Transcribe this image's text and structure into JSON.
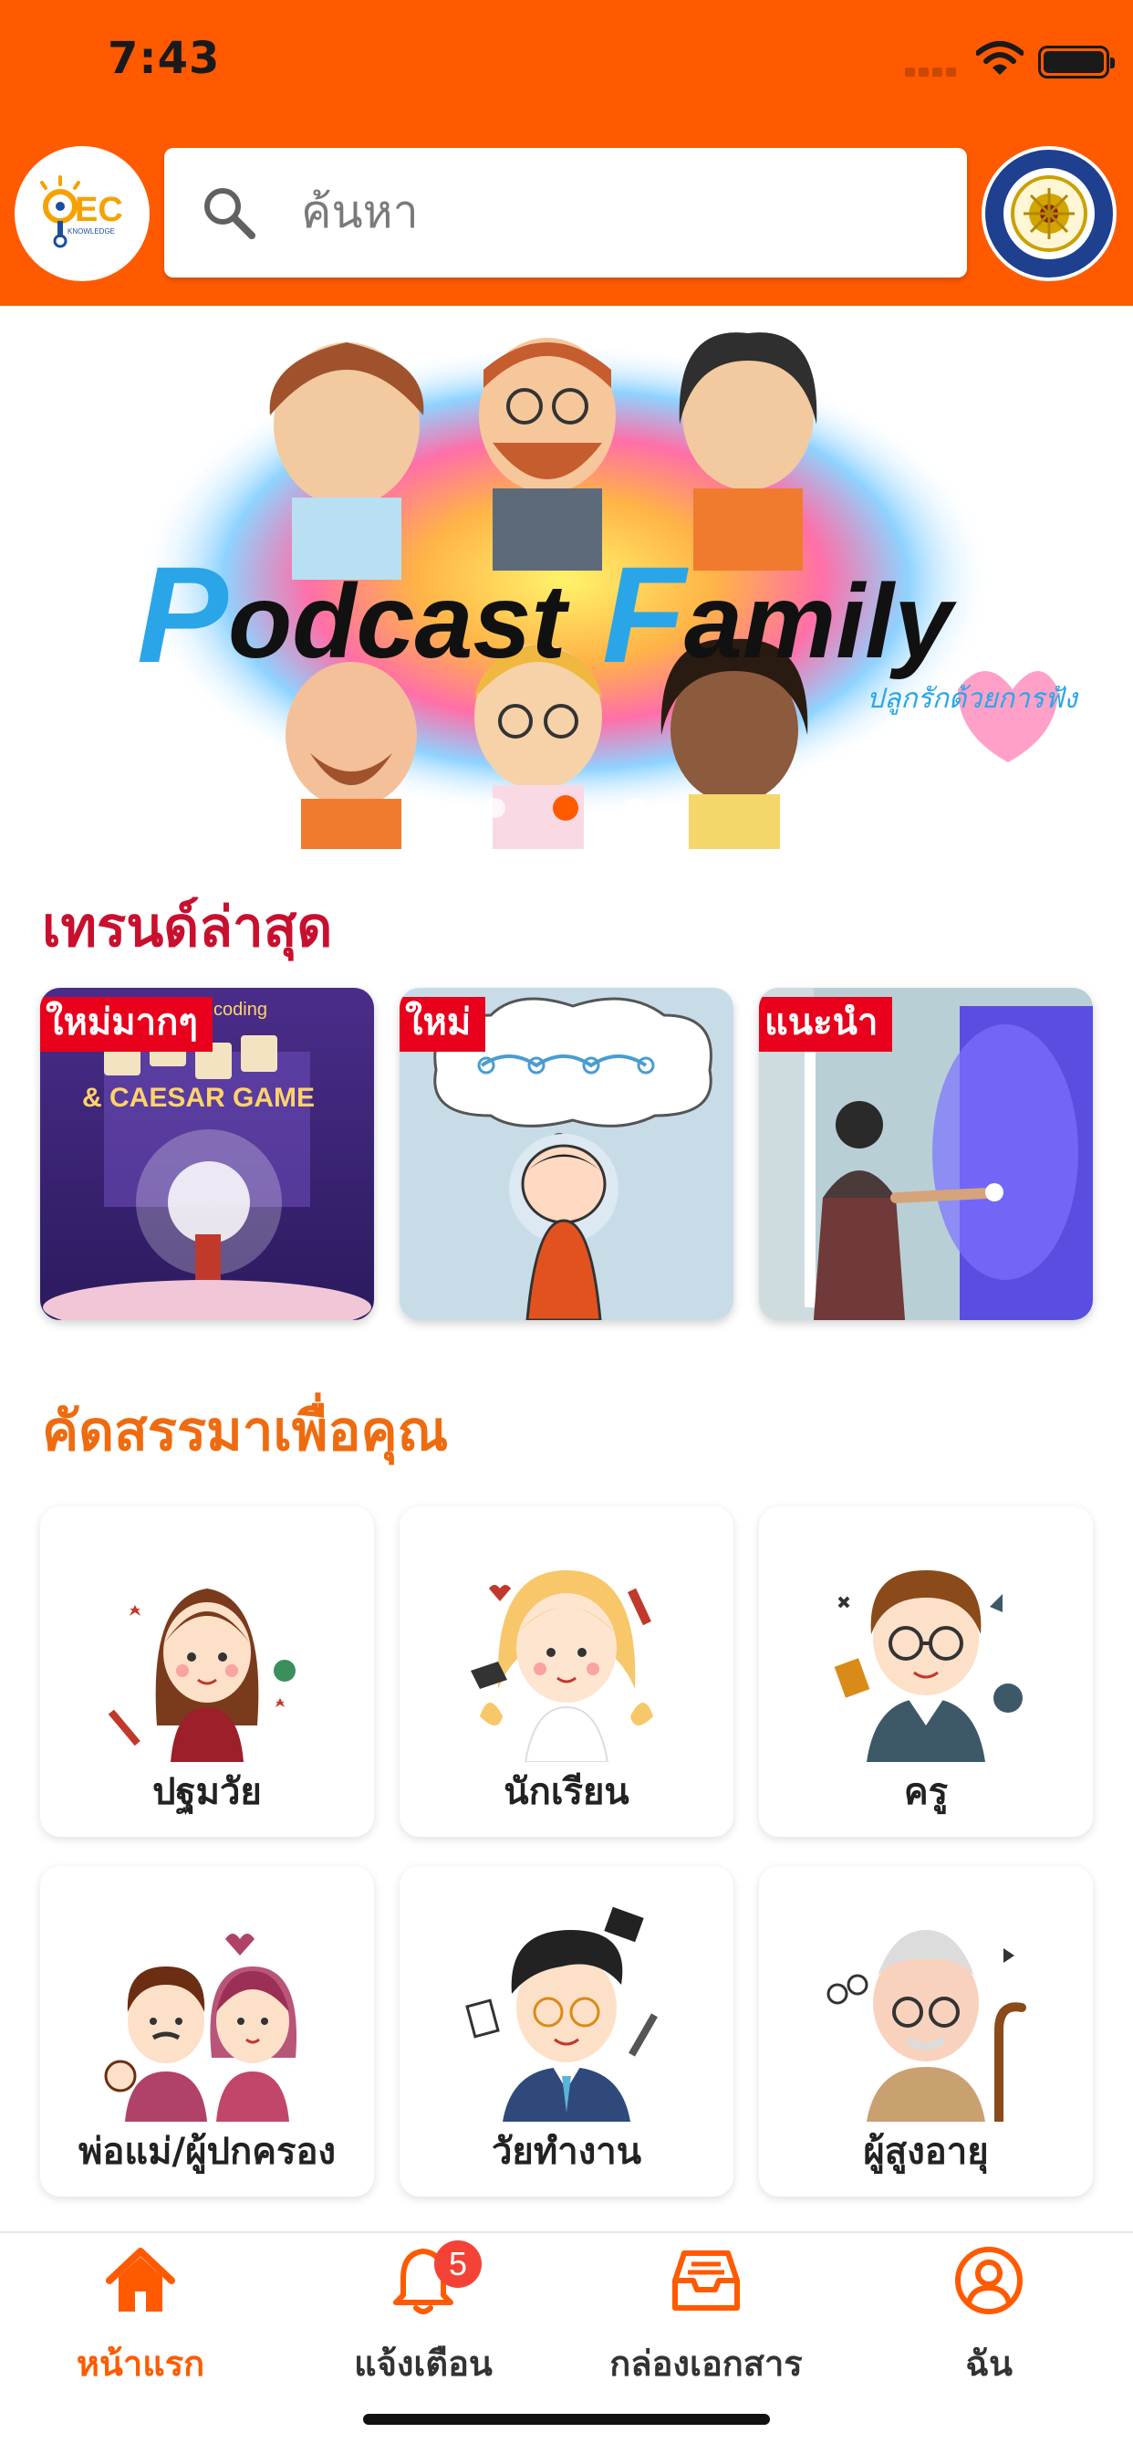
{
  "status_bar": {
    "time": "7:43"
  },
  "header": {
    "logo_left": "OEC Knowledge logo",
    "logo_left_text": "EC",
    "logo_left_sub": "KNOWLEDGE",
    "search": {
      "placeholder": "ค้นหา",
      "value": ""
    },
    "logo_right": "Office of the Education Council seal"
  },
  "banner": {
    "title_part1": "Podcast",
    "title_part2": "Family",
    "tagline": "ปลูกรักด้วยการฟัง",
    "slides": 3,
    "active_slide": 1
  },
  "trending": {
    "title": "เทรนด์ล่าสุด",
    "items": [
      {
        "tag": "ใหม่มากๆ",
        "art_text": "& CAESAR GAME",
        "art_text_top": "coding"
      },
      {
        "tag": "ใหม่"
      },
      {
        "tag": "แนะนำ"
      }
    ]
  },
  "picks": {
    "title": "คัดสรรมาเพื่อคุณ",
    "items": [
      {
        "label": "ปฐมวัย"
      },
      {
        "label": "นักเรียน"
      },
      {
        "label": "ครู"
      },
      {
        "label": "พ่อแม่/ผู้ปกครอง"
      },
      {
        "label": "วัยทำงาน"
      },
      {
        "label": "ผู้สูงอายุ"
      }
    ]
  },
  "tabbar": {
    "items": [
      {
        "label": "หน้าแรก",
        "icon": "home-icon",
        "active": true
      },
      {
        "label": "แจ้งเตือน",
        "icon": "bell-icon",
        "badge": "5"
      },
      {
        "label": "กล่องเอกสาร",
        "icon": "inbox-icon"
      },
      {
        "label": "ฉัน",
        "icon": "user-icon"
      }
    ]
  },
  "colors": {
    "primary": "#ff5a00",
    "trend_title": "#c8102e",
    "pick_title": "#ef6b0f",
    "tag": "#e8001c",
    "badge": "#f44336"
  }
}
